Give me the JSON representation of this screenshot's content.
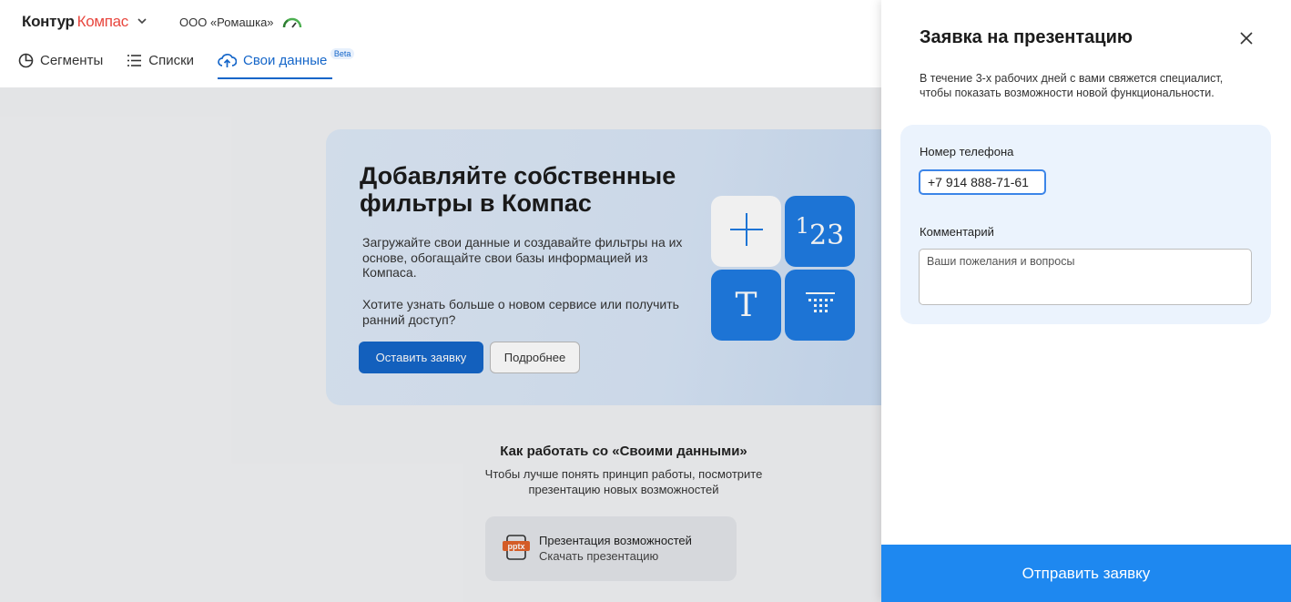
{
  "header": {
    "brand_primary": "Контур",
    "brand_secondary": "Компас",
    "org_name": "ООО «Ромашка»"
  },
  "tabs": [
    {
      "label": "Сегменты",
      "icon": "pie-chart-icon"
    },
    {
      "label": "Списки",
      "icon": "list-icon"
    },
    {
      "label": "Свои данные",
      "icon": "cloud-upload-icon",
      "badge": "Beta",
      "active": true
    }
  ],
  "promo": {
    "title": "Добавляйте собственные фильтры в Компас",
    "text": "Загружайте свои данные и создавайте фильтры на их основе, обогащайте свои базы информацией из Компаса.",
    "text2": "Хотите узнать больше о новом сервисе или получить ранний доступ?",
    "primary_button": "Оставить заявку",
    "secondary_button": "Подробнее",
    "tile_number_sup": "1",
    "tile_number_sub": "2",
    "tile_number_sub2": "3",
    "tile_letter": "T"
  },
  "howto": {
    "title": "Как работать со «Своими данными»",
    "subtitle": "Чтобы лучше понять принцип работы, посмотрите презентацию новых возможностей",
    "card_title": "Презентация возможностей",
    "card_subtitle": "Скачать презентацию",
    "card_icon_label": "pptx"
  },
  "panel": {
    "title": "Заявка на презентацию",
    "description": "В течение 3-х рабочих дней с вами свяжется специалист, чтобы показать возможности новой функциональности.",
    "phone_label": "Номер телефона",
    "phone_value": "+7 914 888-71-61",
    "comment_label": "Комментарий",
    "comment_placeholder": "Ваши пожелания и вопросы",
    "submit_label": "Отправить заявку"
  },
  "colors": {
    "accent": "#1566c9",
    "submit": "#1e88f0",
    "brand_red": "#e8473f",
    "tile_blue": "#1f7ce3",
    "pptx_orange": "#e2622a"
  }
}
